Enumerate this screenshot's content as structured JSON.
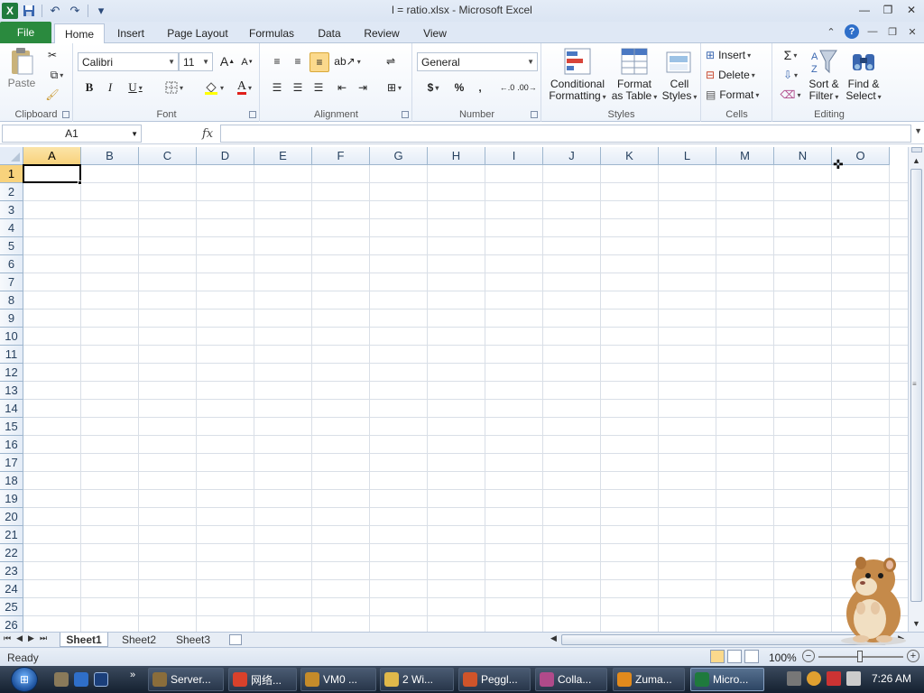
{
  "window": {
    "title": "l = ratio.xlsx - Microsoft Excel",
    "controls": [
      "minimize-icon",
      "restore-icon",
      "close-icon"
    ]
  },
  "qat": {
    "icons": [
      "save-icon",
      "undo-icon",
      "redo-icon",
      "customize-qat-icon"
    ]
  },
  "tabs": {
    "file": "File",
    "items": [
      "Home",
      "Insert",
      "Page Layout",
      "Formulas",
      "Data",
      "Review",
      "View"
    ],
    "active": "Home"
  },
  "ribbon": {
    "clipboard": {
      "label": "Clipboard",
      "paste": "Paste"
    },
    "font": {
      "label": "Font",
      "family": "Calibri",
      "size": "11"
    },
    "alignment": {
      "label": "Alignment"
    },
    "number": {
      "label": "Number",
      "format": "General",
      "currency": "$",
      "percent": "%",
      "comma": ","
    },
    "styles": {
      "label": "Styles",
      "conditional_line1": "Conditional",
      "conditional_line2": "Formatting",
      "table_line1": "Format",
      "table_line2": "as Table",
      "cell_line1": "Cell",
      "cell_line2": "Styles"
    },
    "cells": {
      "label": "Cells",
      "insert": "Insert",
      "delete": "Delete",
      "format": "Format"
    },
    "editing": {
      "label": "Editing",
      "sort_line1": "Sort &",
      "sort_line2": "Filter",
      "find_line1": "Find &",
      "find_line2": "Select"
    }
  },
  "formula_bar": {
    "name_box": "A1",
    "fx": "fx",
    "value": ""
  },
  "grid": {
    "columns": [
      "A",
      "B",
      "C",
      "D",
      "E",
      "F",
      "G",
      "H",
      "I",
      "J",
      "K",
      "L",
      "M",
      "N",
      "O"
    ],
    "rows": [
      "1",
      "2",
      "3",
      "4",
      "5",
      "6",
      "7",
      "8",
      "9",
      "10",
      "11",
      "12",
      "13",
      "14",
      "15",
      "16",
      "17",
      "18",
      "19",
      "20",
      "21",
      "22",
      "23",
      "24",
      "25",
      "26"
    ],
    "active_cell": "A1"
  },
  "sheets": {
    "items": [
      "Sheet1",
      "Sheet2",
      "Sheet3"
    ],
    "active": "Sheet1"
  },
  "status": {
    "mode": "Ready",
    "zoom": "100%",
    "zoom_level": 1.0
  },
  "taskbar": {
    "items": [
      {
        "label": "Server...",
        "icon": "server-app-icon",
        "color": "#8a6d3b"
      },
      {
        "label": "网络...",
        "icon": "chrome-icon",
        "color": "#d9412b"
      },
      {
        "label": "VM0 ...",
        "icon": "vm-icon",
        "color": "#c58b2a"
      },
      {
        "label": "2 Wi...",
        "icon": "explorer-folder-icon",
        "color": "#e0b84a"
      },
      {
        "label": "Peggl...",
        "icon": "peggle-icon",
        "color": "#d0542a"
      },
      {
        "label": "Colla...",
        "icon": "collage-icon",
        "color": "#b04a8a"
      },
      {
        "label": "Zuma...",
        "icon": "zuma-icon",
        "color": "#e28a1c"
      },
      {
        "label": "Micro...",
        "icon": "excel-icon",
        "color": "#1f7a3d"
      }
    ],
    "clock": "7:26 AM"
  }
}
